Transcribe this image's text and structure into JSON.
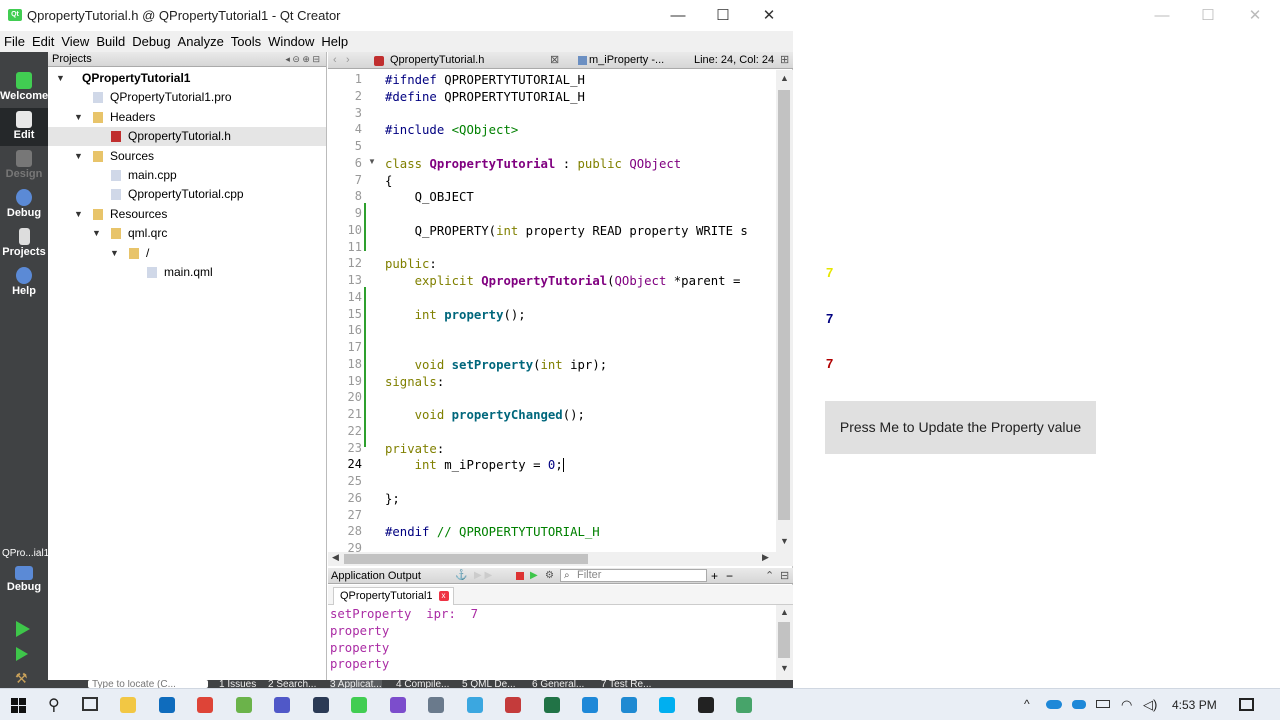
{
  "window": {
    "title": "QpropertyTutorial.h @ QPropertyTutorial1 - Qt Creator",
    "app_icon": "qt-logo",
    "controls": [
      "—",
      "☐",
      "✕"
    ]
  },
  "menu": [
    "File",
    "Edit",
    "View",
    "Build",
    "Debug",
    "Analyze",
    "Tools",
    "Window",
    "Help"
  ],
  "modes": [
    {
      "label": "Welcome",
      "icon": "qt-logo",
      "color": "#41cd52"
    },
    {
      "label": "Edit",
      "icon": "edit-icon",
      "color": "#e8e8e8"
    },
    {
      "label": "Design",
      "icon": "design-icon",
      "color": "#777777"
    },
    {
      "label": "Debug",
      "icon": "debug-icon",
      "color": "#5b8ad6"
    },
    {
      "label": "Projects",
      "icon": "projects-icon",
      "color": "#dddddd"
    },
    {
      "label": "Help",
      "icon": "help-icon",
      "color": "#5b8ad6"
    }
  ],
  "kit": {
    "name": "QPro...ial1",
    "mode": "Debug"
  },
  "projects": {
    "header": "Projects",
    "tree": [
      {
        "label": "QPropertyTutorial1",
        "depth": 0,
        "arrow": "▼",
        "bold": true
      },
      {
        "label": "QPropertyTutorial1.pro",
        "depth": 1,
        "arrow": ""
      },
      {
        "label": "Headers",
        "depth": 1,
        "arrow": "▼"
      },
      {
        "label": "QpropertyTutorial.h",
        "depth": 2,
        "arrow": "",
        "selected": true
      },
      {
        "label": "Sources",
        "depth": 1,
        "arrow": "▼"
      },
      {
        "label": "main.cpp",
        "depth": 2,
        "arrow": ""
      },
      {
        "label": "QpropertyTutorial.cpp",
        "depth": 2,
        "arrow": ""
      },
      {
        "label": "Resources",
        "depth": 1,
        "arrow": "▼"
      },
      {
        "label": "qml.qrc",
        "depth": 2,
        "arrow": "▼"
      },
      {
        "label": "/",
        "depth": 3,
        "arrow": "▼"
      },
      {
        "label": "main.qml",
        "depth": 4,
        "arrow": ""
      }
    ]
  },
  "editor": {
    "file_tab": "QpropertyTutorial.h",
    "symbol": "m_iProperty -...",
    "position": "Line: 24, Col: 24",
    "current_line": 24,
    "lines": [
      "#ifndef QPROPERTYTUTORIAL_H",
      "#define QPROPERTYTUTORIAL_H",
      "",
      "#include <QObject>",
      "",
      "class QpropertyTutorial : public QObject",
      "{",
      "    Q_OBJECT",
      "",
      "    Q_PROPERTY(int property READ property WRITE s",
      "",
      "public:",
      "    explicit QpropertyTutorial(QObject *parent = ",
      "",
      "    int property();",
      "",
      "",
      "    void setProperty(int ipr);",
      "signals:",
      "",
      "    void propertyChanged();",
      "",
      "private:",
      "    int m_iProperty = 0;",
      "",
      "};",
      "",
      "#endif // QPROPERTYTUTORIAL_H",
      ""
    ]
  },
  "output": {
    "title": "Application Output",
    "filter_placeholder": "Filter",
    "tab": "QPropertyTutorial1",
    "lines": [
      "setProperty  ipr:  7",
      "property",
      "property",
      "property"
    ]
  },
  "bottom_tabs": [
    "Type to locate (C...",
    "1 Issues",
    "2 Search...",
    "3 Applicat...",
    "4 Compile...",
    "5 QML De...",
    "6 General...",
    "7 Test Re..."
  ],
  "preview": {
    "values": [
      {
        "text": "7",
        "color": "#e6e600"
      },
      {
        "text": "7",
        "color": "#000080"
      },
      {
        "text": "7",
        "color": "#b00000"
      }
    ],
    "button": "Press Me to Update the Property value",
    "controls": [
      "—",
      "☐",
      "✕"
    ]
  },
  "taskbar": {
    "time": "4:53 PM",
    "apps": [
      {
        "icon": "file-explorer-icon",
        "color": "#f2c744"
      },
      {
        "icon": "outlook-icon",
        "color": "#0f6cbd"
      },
      {
        "icon": "chrome-icon",
        "color": "#de4437"
      },
      {
        "icon": "notepad-icon",
        "color": "#6bb34a"
      },
      {
        "icon": "teams-icon",
        "color": "#5058c8"
      },
      {
        "icon": "package-icon",
        "color": "#2b3a55"
      },
      {
        "icon": "qt-creator-icon",
        "color": "#41cd52"
      },
      {
        "icon": "visual-studio-icon",
        "color": "#7c4dcc"
      },
      {
        "icon": "settings-icon",
        "color": "#6a7a8c"
      },
      {
        "icon": "paint-icon",
        "color": "#3ba7e0"
      },
      {
        "icon": "monitor-icon",
        "color": "#c43b3b"
      },
      {
        "icon": "excel-icon",
        "color": "#217346"
      },
      {
        "icon": "edge-icon",
        "color": "#1e88d8"
      },
      {
        "icon": "vscode-icon",
        "color": "#1f8ad2"
      },
      {
        "icon": "skype-icon",
        "color": "#00aff0"
      },
      {
        "icon": "obs-icon",
        "color": "#222222"
      },
      {
        "icon": "app-icon",
        "color": "#47a46a"
      }
    ],
    "tray": [
      "^",
      "cloud-icon",
      "onedrive-icon",
      "battery-icon",
      "wifi-icon",
      "volume-icon"
    ]
  }
}
